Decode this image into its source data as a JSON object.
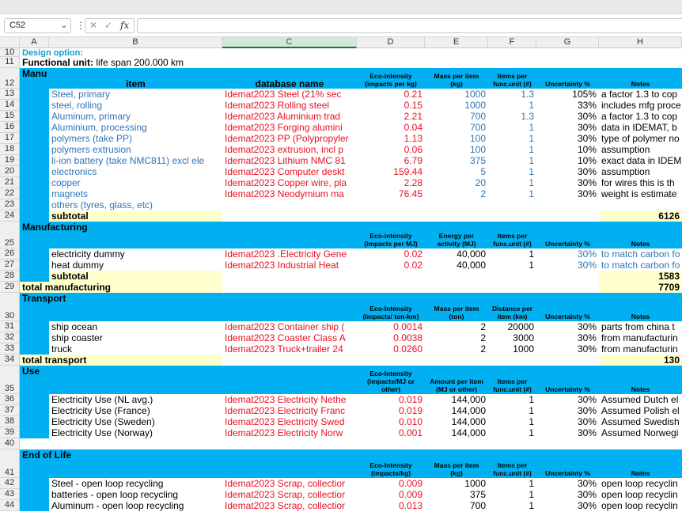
{
  "formula_bar": {
    "name_box": "C52",
    "fx_label": "fx",
    "formula": ""
  },
  "columns": [
    "A",
    "B",
    "C",
    "D",
    "E",
    "F",
    "G",
    "H"
  ],
  "rows": [
    {
      "n": "10",
      "kind": "plain",
      "a": "Design option:",
      "a_color": "teal"
    },
    {
      "n": "11",
      "kind": "plain",
      "a": "Functional unit:",
      "a_rest": " life span 200.000 km"
    },
    {
      "n": "12",
      "kind": "header",
      "a": "Manu",
      "b": "item",
      "c": "database name",
      "d": "Eco-intensity (impacts per kg)",
      "e": "Mass per item (kg)",
      "f": "Items per func.unit (#)",
      "g": "Uncertainty %",
      "h": "Notes"
    },
    {
      "n": "13",
      "kind": "data",
      "b": "Steel, primary",
      "c": "Idemat2023 Steel (21% sec",
      "d": "0.21",
      "e": "1000",
      "f": "1.3",
      "g": "105%",
      "h": "a factor 1.3 to cop",
      "bc": "blue",
      "ec": "blue"
    },
    {
      "n": "14",
      "kind": "data",
      "b": "steel, rolling",
      "c": "Idemat2023 Rolling steel",
      "d": "0.15",
      "e": "1000",
      "f": "1",
      "g": "33%",
      "h": "includes mfg proce",
      "bc": "blue",
      "ec": "blue"
    },
    {
      "n": "15",
      "kind": "data",
      "b": "Aluminum, primary",
      "c": "Idemat2023 Aluminium trad",
      "d": "2.21",
      "e": "700",
      "f": "1.3",
      "g": "30%",
      "h": "a factor 1.3 to cop",
      "bc": "blue",
      "ec": "blue"
    },
    {
      "n": "16",
      "kind": "data",
      "b": "Aluminium, processing",
      "c": "Idemat2023 Forging alumini",
      "d": "0.04",
      "e": "700",
      "f": "1",
      "g": "30%",
      "h": "data in IDEMAT, b",
      "bc": "blue",
      "ec": "blue"
    },
    {
      "n": "17",
      "kind": "data",
      "b": "polymers (take PP)",
      "c": "Idemat2023 PP (Polypropyler",
      "d": "1.13",
      "e": "100",
      "f": "1",
      "g": "30%",
      "h": "type of polymer no",
      "bc": "blue",
      "ec": "blue"
    },
    {
      "n": "18",
      "kind": "data",
      "b": "polymers extrusion",
      "c": "Idemat2023 extrusion, incl p",
      "d": "0.06",
      "e": "100",
      "f": "1",
      "g": "10%",
      "h": "assumption",
      "bc": "blue",
      "ec": "blue"
    },
    {
      "n": "19",
      "kind": "data",
      "b": "li-ion battery (take NMC811) excl ele",
      "c": "Idemat2023 Lithium NMC 81",
      "d": "6.79",
      "e": "375",
      "f": "1",
      "g": "10%",
      "h": "exact data in IDEM",
      "bc": "blue",
      "ec": "blue"
    },
    {
      "n": "20",
      "kind": "data",
      "b": "electronics",
      "c": "Idemat2023 Computer deskt",
      "d": "159.44",
      "e": "5",
      "f": "1",
      "g": "30%",
      "h": "assumption",
      "bc": "blue",
      "ec": "blue"
    },
    {
      "n": "21",
      "kind": "data",
      "b": "copper",
      "c": "Idemat2023 Copper wire, pla",
      "d": "2.28",
      "e": "20",
      "f": "1",
      "g": "30%",
      "h": "for wires this is th",
      "bc": "blue",
      "ec": "blue"
    },
    {
      "n": "22",
      "kind": "data",
      "b": "magnets",
      "c": "Idemat2023 Neodymium ma",
      "d": "76.45",
      "e": "2",
      "f": "1",
      "g": "30%",
      "h": "weight is estimate",
      "bc": "blue",
      "ec": "blue"
    },
    {
      "n": "23",
      "kind": "data",
      "b": "others (tyres, glass, etc)",
      "c": "",
      "d": "",
      "e": "",
      "f": "",
      "g": "",
      "h": "",
      "bc": "blue"
    },
    {
      "n": "24",
      "kind": "subtotal",
      "b": "subtotal",
      "h": "6126"
    },
    {
      "n": "25",
      "kind": "header",
      "a": "Manufacturing",
      "d": "Eco-intensity (impacts per MJ)",
      "e": "Energy per activity (MJ)",
      "f": "Items per func.unit (#)",
      "g": "Uncertainty %",
      "h": "Notes"
    },
    {
      "n": "26",
      "kind": "data",
      "b": "electricity dummy",
      "c": "Idemat2023 .Electricity Gene",
      "d": "0.02",
      "e": "40,000",
      "f": "1",
      "g": "30%",
      "h": "to match carbon fo",
      "gc": "blue",
      "hc": "blue"
    },
    {
      "n": "27",
      "kind": "data",
      "b": "heat dummy",
      "c": "Idemat2023  Industrial Heat",
      "d": "0.02",
      "e": "40,000",
      "f": "1",
      "g": "30%",
      "h": "to match carbon fo",
      "gc": "blue",
      "hc": "blue"
    },
    {
      "n": "28",
      "kind": "subtotal",
      "b": "subtotal",
      "h": "1583"
    },
    {
      "n": "29",
      "kind": "total",
      "a": "total manufacturing",
      "h": "7709"
    },
    {
      "n": "30",
      "kind": "header",
      "a": "Transport",
      "d": "Eco-Intensity (impacts/ ton-km)",
      "e": "Mass per item (ton)",
      "f": "Distance per item (km)",
      "g": "Uncertainty %",
      "h": "Notes"
    },
    {
      "n": "31",
      "kind": "data",
      "b": "ship ocean",
      "c": "Idemat2023 Container ship (",
      "d": "0.0014",
      "e": "2",
      "f": "20000",
      "g": "30%",
      "h": "parts from china t"
    },
    {
      "n": "32",
      "kind": "data",
      "b": "ship coaster",
      "c": "Idemat2023 Coaster Class A",
      "d": "0.0038",
      "e": "2",
      "f": "3000",
      "g": "30%",
      "h": "from manufacturin"
    },
    {
      "n": "33",
      "kind": "data",
      "b": "truck",
      "c": "Idemat2023 Truck+trailer 24",
      "d": "0.0260",
      "e": "2",
      "f": "1000",
      "g": "30%",
      "h": "from manufacturin"
    },
    {
      "n": "34",
      "kind": "total",
      "a": "total transport",
      "h": "130"
    },
    {
      "n": "35",
      "kind": "header",
      "a": "Use",
      "d": "Eco-Intensity (impacts/MJ or other)",
      "e": "Amount per item (MJ or other)",
      "f": "Items per func.unit (#)",
      "g": "Uncertainty %",
      "h": "Notes"
    },
    {
      "n": "36",
      "kind": "data",
      "b": "Electricity Use (NL avg.)",
      "c": "Idemat2023 Electricity Nethe",
      "d": "0.019",
      "e": "144,000",
      "f": "1",
      "g": "30%",
      "h": "Assumed Dutch el"
    },
    {
      "n": "37",
      "kind": "data",
      "b": "Electricity Use (France)",
      "c": "Idemat2023 Electricity Franc",
      "d": "0.019",
      "e": "144,000",
      "f": "1",
      "g": "30%",
      "h": "Assumed Polish el"
    },
    {
      "n": "38",
      "kind": "data",
      "b": "Electricity Use (Sweden)",
      "c": "Idemat2023 Electricity Swed",
      "d": "0.010",
      "e": "144,000",
      "f": "1",
      "g": "30%",
      "h": "Assumed Swedish"
    },
    {
      "n": "39",
      "kind": "data",
      "b": "Electricity Use (Norway)",
      "c": "Idemat2023 Electricity Norw",
      "d": "0.001",
      "e": "144,000",
      "f": "1",
      "g": "30%",
      "h": "Assumed Norwegi"
    },
    {
      "n": "40",
      "kind": "empty"
    },
    {
      "n": "41",
      "kind": "header",
      "a": "End of Life",
      "d": "Eco-Intensity (impacts/kg)",
      "e": "Mass per item (kg)",
      "f": "Items per func.unit (#)",
      "g": "Uncertainty %",
      "h": "Notes"
    },
    {
      "n": "42",
      "kind": "data",
      "b": "Steel - open loop recycling",
      "c": "Idemat2023 Scrap, collectior",
      "d": "0.009",
      "e": "1000",
      "f": "1",
      "g": "30%",
      "h": "open loop recyclin"
    },
    {
      "n": "43",
      "kind": "data",
      "b": "batteries - open loop recycling",
      "c": "Idemat2023 Scrap, collectior",
      "d": "0.009",
      "e": "375",
      "f": "1",
      "g": "30%",
      "h": "open loop recyclin"
    },
    {
      "n": "44",
      "kind": "data",
      "b": "Aluminum - open loop recycling",
      "c": "Idemat2023 Scrap, collectior",
      "d": "0.013",
      "e": "700",
      "f": "1",
      "g": "30%",
      "h": "open loop recyclin"
    }
  ]
}
